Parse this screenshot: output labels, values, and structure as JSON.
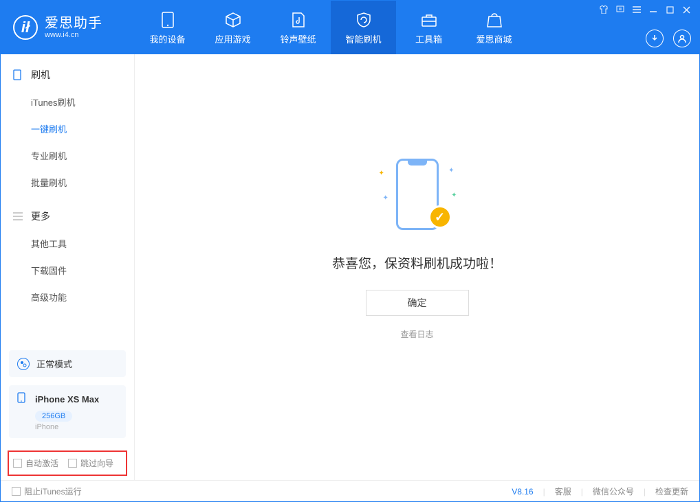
{
  "app": {
    "title": "爱思助手",
    "url": "www.i4.cn"
  },
  "nav": {
    "tabs": [
      {
        "label": "我的设备"
      },
      {
        "label": "应用游戏"
      },
      {
        "label": "铃声壁纸"
      },
      {
        "label": "智能刷机"
      },
      {
        "label": "工具箱"
      },
      {
        "label": "爱思商城"
      }
    ]
  },
  "sidebar": {
    "groups": [
      {
        "title": "刷机",
        "items": [
          {
            "label": "iTunes刷机"
          },
          {
            "label": "一键刷机",
            "active": true
          },
          {
            "label": "专业刷机"
          },
          {
            "label": "批量刷机"
          }
        ]
      },
      {
        "title": "更多",
        "items": [
          {
            "label": "其他工具"
          },
          {
            "label": "下载固件"
          },
          {
            "label": "高级功能"
          }
        ]
      }
    ],
    "mode_label": "正常模式",
    "device": {
      "name": "iPhone XS Max",
      "capacity": "256GB",
      "type": "iPhone"
    },
    "options": {
      "auto_activate": "自动激活",
      "skip_guide": "跳过向导"
    }
  },
  "main": {
    "success_message": "恭喜您，保资料刷机成功啦！",
    "ok_button": "确定",
    "view_log": "查看日志"
  },
  "footer": {
    "block_itunes": "阻止iTunes运行",
    "version": "V8.16",
    "support": "客服",
    "wechat": "微信公众号",
    "check_update": "检查更新"
  }
}
